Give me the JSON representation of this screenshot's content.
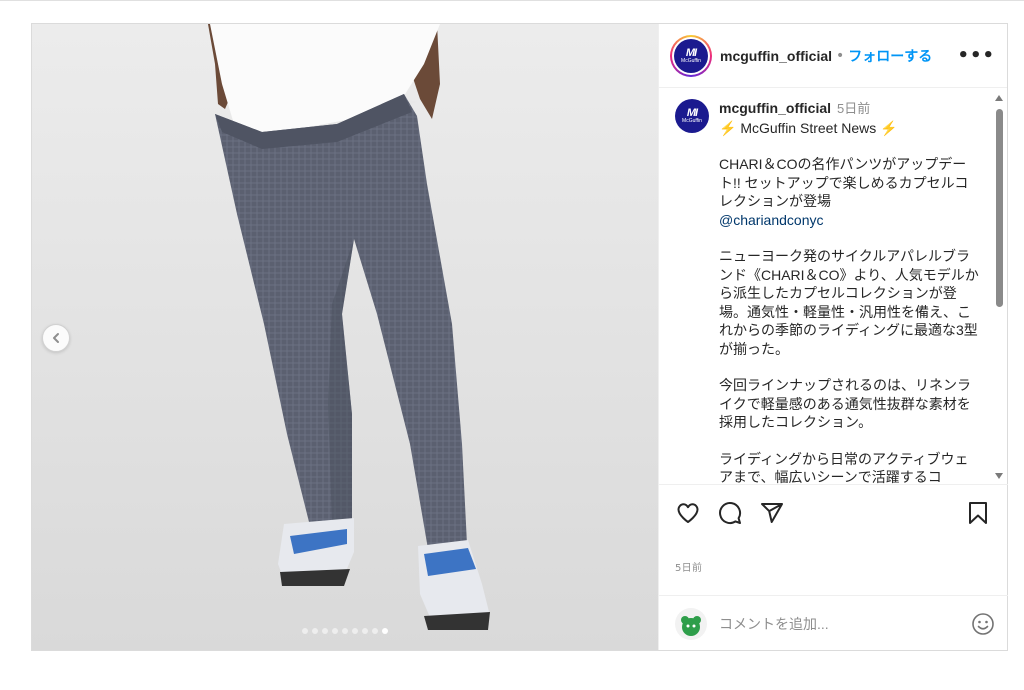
{
  "post": {
    "username": "mcguffin_official",
    "separator": "•",
    "follow_label": "フォローする",
    "more_label": "•••",
    "avatar_logo": "MI",
    "avatar_word": "McGuffin",
    "carousel": {
      "total": 9,
      "active_index": 8
    },
    "media_alt": "グレーのチェック柄パンツと白いスニーカー"
  },
  "caption": {
    "username": "mcguffin_official",
    "time": "5日前",
    "bolt": "⚡",
    "title": "McGuffin Street News",
    "paragraphs": [
      "CHARI＆COの名作パンツがアップデート!! セットアップで楽しめるカプセルコレクションが登場",
      "ニューヨーク発のサイクルアパレルブランド《CHARI＆CO》より、人気モデルから派生したカプセルコレクションが登場。通気性・軽量性・汎用性を備え、これからの季節のライディングに最適な3型が揃った。",
      "今回ラインナップされるのは、リネンライクで軽量感のある通気性抜群な素材を採用したコレクション。",
      "ライディングから日常のアクティブウェアまで、幅広いシーンで活躍するコ"
    ],
    "mention": "@chariandconyc"
  },
  "footer": {
    "post_time": "5日前",
    "comment_placeholder": "コメントを追加..."
  },
  "colors": {
    "accent": "#0095f6",
    "brand": "#1b1a8f",
    "text": "#262626",
    "muted": "#8e8e8e",
    "pants": "#5a5f6e"
  },
  "icons": [
    "chevron-left-icon",
    "more-icon",
    "heart-icon",
    "comment-icon",
    "share-icon",
    "bookmark-icon",
    "emoji-icon",
    "lightning-icon"
  ]
}
